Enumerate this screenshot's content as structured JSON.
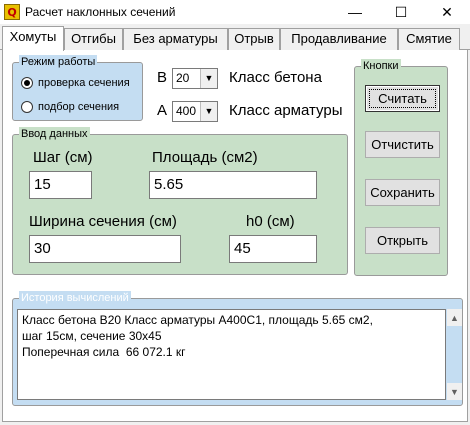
{
  "window": {
    "title": "Расчет наклонных сечений",
    "icon_glyph": "Q",
    "minimize_glyph": "—",
    "maximize_glyph": "☐",
    "close_glyph": "✕"
  },
  "tabs": [
    {
      "label": "Хомуты",
      "active": true
    },
    {
      "label": "Отгибы",
      "active": false
    },
    {
      "label": "Без арматуры",
      "active": false
    },
    {
      "label": "Отрыв",
      "active": false
    },
    {
      "label": "Продавливание",
      "active": false
    },
    {
      "label": "Смятие",
      "active": false
    }
  ],
  "mode": {
    "legend": "Режим работы",
    "options": [
      {
        "label": "проверка сечения",
        "selected": true
      },
      {
        "label": "подбор сечения",
        "selected": false
      }
    ]
  },
  "concrete": {
    "prefix": "B",
    "value": "20",
    "label": "Класс бетона"
  },
  "rebar": {
    "prefix": "A",
    "value": "400",
    "label": "Класс арматуры"
  },
  "input": {
    "legend": "Ввод данных",
    "step_label": "Шаг (см)",
    "step_value": "15",
    "area_label": "Площадь (см2)",
    "area_value": "5.65",
    "width_label": "Ширина сечения (см)",
    "width_value": "30",
    "h0_label": "h0 (см)",
    "h0_value": "45"
  },
  "buttons": {
    "legend": "Кнопки",
    "calculate": "Считать",
    "clear": "Отчистить",
    "save": "Сохранить",
    "open": "Открыть"
  },
  "history": {
    "legend": "История вычислений",
    "text": "Класс бетона B20 Класс арматуры A400C1, площадь 5.65 см2,\nшаг 15см, сечение 30x45\nПоперечная сила  66 072.1 кг"
  },
  "scroll": {
    "up_glyph": "▲",
    "down_glyph": "▼"
  },
  "colors": {
    "green_panel": "#c8e0c8",
    "blue_panel": "#c4ddf2"
  }
}
